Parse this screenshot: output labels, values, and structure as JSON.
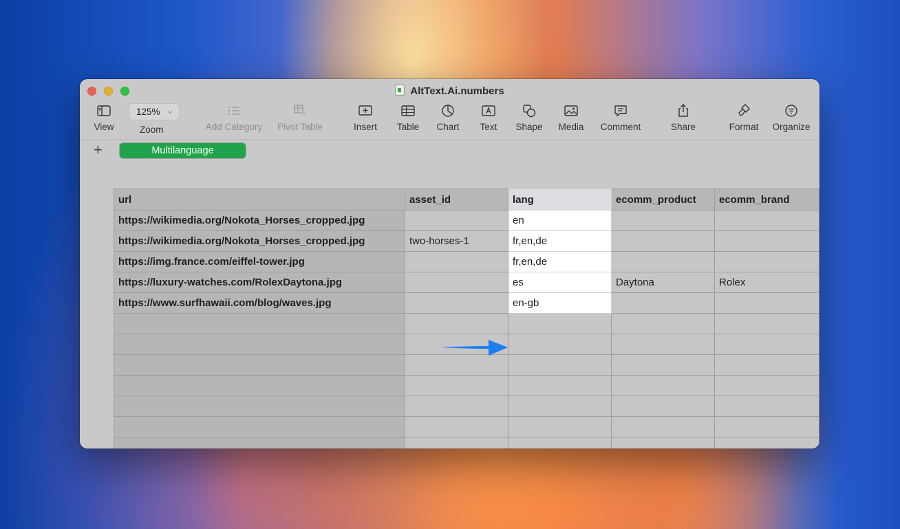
{
  "window": {
    "title": "AltText.Ai.numbers"
  },
  "toolbar": {
    "view": "View",
    "zoom_value": "125%",
    "zoom": "Zoom",
    "add_category": "Add Category",
    "pivot_table": "Pivot Table",
    "insert": "Insert",
    "table": "Table",
    "chart": "Chart",
    "text": "Text",
    "shape": "Shape",
    "media": "Media",
    "comment": "Comment",
    "share": "Share",
    "format": "Format",
    "organize": "Organize"
  },
  "sheets": {
    "active": "Multilanguage"
  },
  "table": {
    "headers": [
      "url",
      "asset_id",
      "lang",
      "ecomm_product",
      "ecomm_brand"
    ],
    "rows": [
      [
        "https://wikimedia.org/Nokota_Horses_cropped.jpg",
        "",
        "en",
        "",
        ""
      ],
      [
        "https://wikimedia.org/Nokota_Horses_cropped.jpg",
        "two-horses-1",
        "fr,en,de",
        "",
        ""
      ],
      [
        "https://img.france.com/eiffel-tower.jpg",
        "",
        "fr,en,de",
        "",
        ""
      ],
      [
        "https://luxury-watches.com/RolexDaytona.jpg",
        "",
        "es",
        "Daytona",
        "Rolex"
      ],
      [
        "https://www.surfhawaii.com/blog/waves.jpg",
        "",
        "en-gb",
        "",
        ""
      ]
    ],
    "highlighted_column": "lang",
    "arrow_color": "#1a7ff0"
  }
}
